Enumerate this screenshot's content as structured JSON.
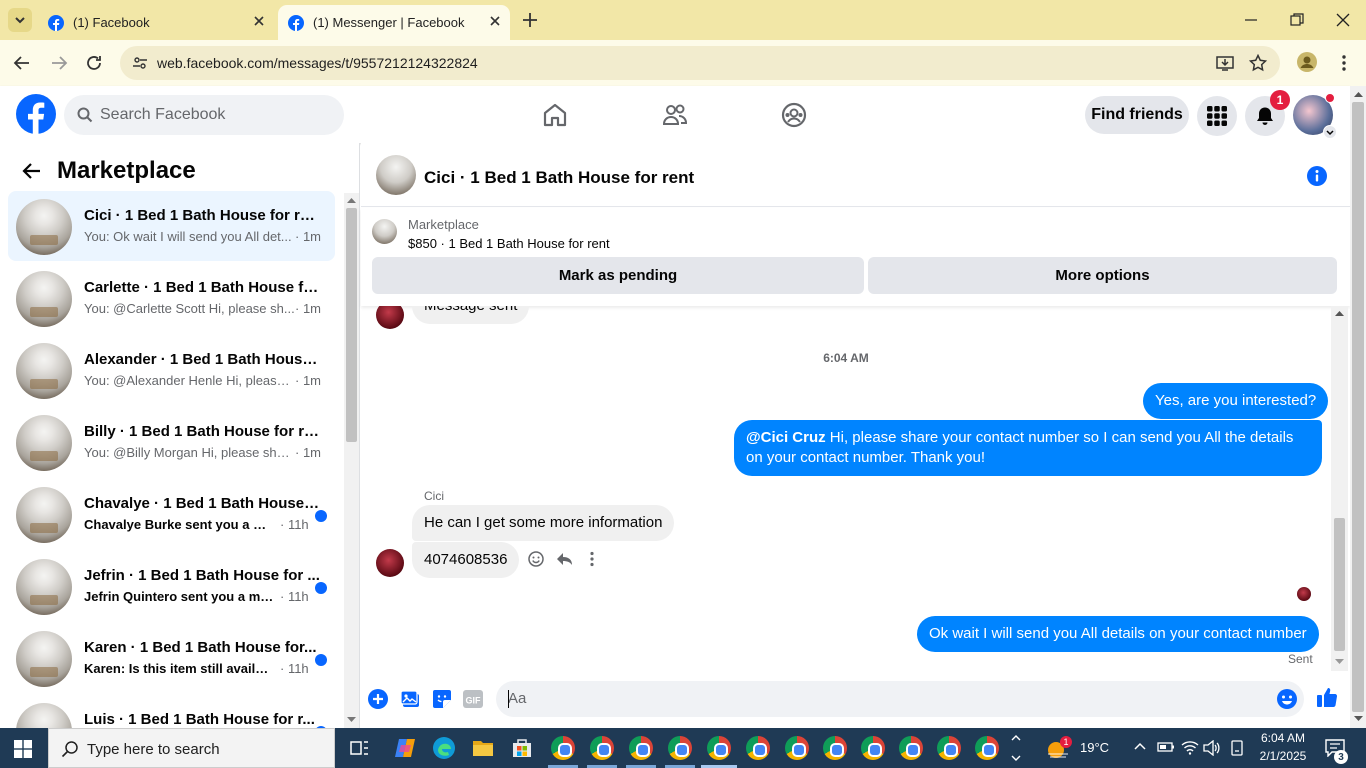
{
  "browser": {
    "tabs": [
      {
        "title": "(1) Facebook",
        "active": false
      },
      {
        "title": "(1) Messenger | Facebook",
        "active": true
      }
    ],
    "url": "web.facebook.com/messages/t/9557212124322824"
  },
  "facebook": {
    "search_placeholder": "Search Facebook",
    "find_friends_label": "Find friends",
    "notification_count": "1"
  },
  "sidebar": {
    "title": "Marketplace",
    "conversations": [
      {
        "name": "Cici · 1 Bed 1 Bath House for rent",
        "preview": "You: Ok wait I will send you All det...",
        "time": "· 1m",
        "unread": false,
        "active": true
      },
      {
        "name": "Carlette · 1 Bed 1 Bath House for...",
        "preview": "You: @Carlette Scott Hi, please sh...",
        "time": "· 1m",
        "unread": false,
        "active": false
      },
      {
        "name": "Alexander · 1 Bed 1 Bath House f...",
        "preview": "You: @Alexander Henle Hi, please ...",
        "time": "· 1m",
        "unread": false,
        "active": false
      },
      {
        "name": "Billy · 1 Bed 1 Bath House for rent",
        "preview": "You: @Billy Morgan Hi, please shar...",
        "time": "· 1m",
        "unread": false,
        "active": false
      },
      {
        "name": "Chavalye · 1 Bed 1 Bath House ...",
        "preview": "Chavalye Burke sent you a mes...",
        "time": "· 11h",
        "unread": true,
        "active": false
      },
      {
        "name": "Jefrin · 1 Bed 1 Bath House for ...",
        "preview": "Jefrin Quintero sent you a mes...",
        "time": "· 11h",
        "unread": true,
        "active": false
      },
      {
        "name": "Karen · 1 Bed 1 Bath House for...",
        "preview": "Karen: Is this item still available?",
        "time": "· 11h",
        "unread": true,
        "active": false
      },
      {
        "name": "Luis · 1 Bed 1 Bath House for r...",
        "preview": "",
        "time": "",
        "unread": true,
        "active": false
      }
    ]
  },
  "chat": {
    "title": "Cici · 1 Bed 1 Bath House for rent",
    "listing_label": "Marketplace",
    "listing_price_title": "$850 · 1 Bed 1 Bath House for rent",
    "mark_pending_label": "Mark as pending",
    "more_options_label": "More options",
    "messages": {
      "sent_notice": "Message sent",
      "timestamp": "6:04 AM",
      "out_1": "Yes, are you interested?",
      "out_2_mention": "@Cici Cruz",
      "out_2_text": " Hi, please share your contact number so I can send you All the details on your contact number. Thank you!",
      "sender_name": "Cici",
      "in_1": "He can I get some more information",
      "in_2": "4074608536",
      "out_3": "Ok wait I will send you All details on your contact number",
      "status": "Sent"
    },
    "composer_placeholder": "Aa"
  },
  "taskbar": {
    "search_placeholder": "Type here to search",
    "weather": "19°C",
    "time": "6:04 AM",
    "date": "2/1/2025",
    "notification_count": "3",
    "weather_badge": "1"
  },
  "colors": {
    "fb_blue": "#0866ff",
    "out_bubble": "#0084ff",
    "in_bubble": "#f0f0f0",
    "tabbar": "#f2e7a7"
  }
}
